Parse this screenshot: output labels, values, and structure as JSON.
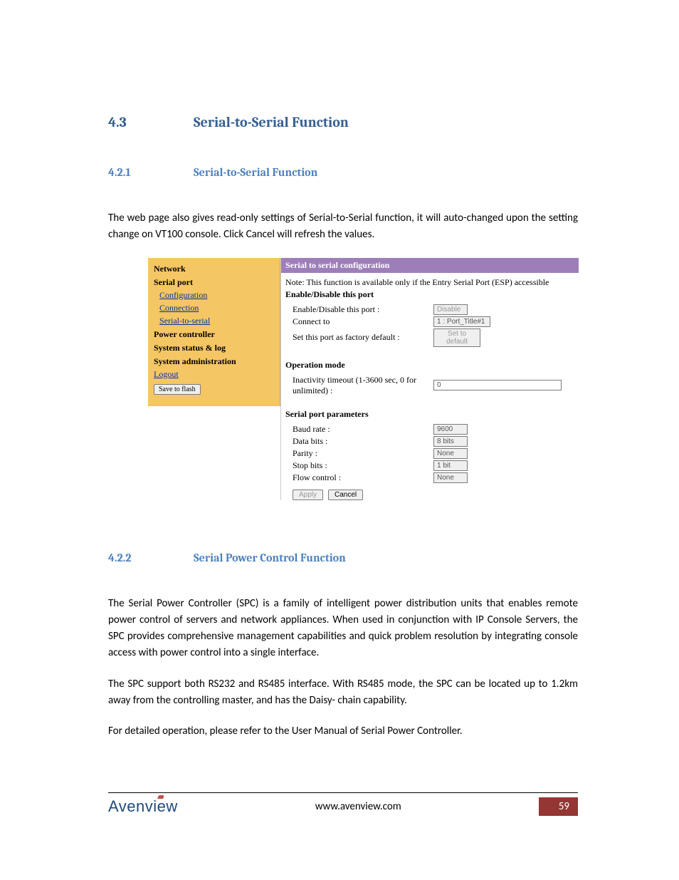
{
  "section43": {
    "number": "4.3",
    "title": "Serial-to-Serial Function"
  },
  "section421": {
    "number": "4.2.1",
    "title": "Serial-to-Serial Function"
  },
  "para421": "The web page also gives read-only settings of Serial-to-Serial function, it will auto-changed upon the setting change on VT100 console. Click Cancel will refresh the values.",
  "figure": {
    "sidebar": {
      "network": "Network",
      "serial_port": "Serial port",
      "links": [
        "Configuration",
        "Connection",
        "Serial-to-serial"
      ],
      "power_controller": "Power controller",
      "status_log": "System status & log",
      "sys_admin": "System administration",
      "logout": "Logout",
      "save_btn": "Save to flash"
    },
    "titlebar": "Serial to serial configuration",
    "note": "Note: This function is available only if the Entry Serial Port (ESP) accessible",
    "enable_section": "Enable/Disable this port",
    "rows": {
      "enable_label": "Enable/Disable this port :",
      "enable_val": "Disable",
      "connect_label": "Connect to",
      "connect_val": "1 : Port_Title#1",
      "factory_label": "Set this port as factory default :",
      "factory_btn": "Set to default"
    },
    "op_mode": "Operation mode",
    "inactivity_label": "Inactivity timeout (1-3600 sec, 0 for unlimited) :",
    "inactivity_val": "0",
    "spp": "Serial port parameters",
    "params": {
      "baud_label": "Baud rate :",
      "baud_val": "9600",
      "data_label": "Data bits :",
      "data_val": "8 bits",
      "parity_label": "Parity :",
      "parity_val": "None",
      "stop_label": "Stop bits :",
      "stop_val": "1 bit",
      "flow_label": "Flow control :",
      "flow_val": "None"
    },
    "apply": "Apply",
    "cancel": "Cancel"
  },
  "section422": {
    "number": "4.2.2",
    "title": "Serial Power Control Function"
  },
  "para422a": "The Serial Power Controller (SPC) is a family of intelligent power distribution units that enables remote power control of servers and network appliances. When used in conjunction with IP Console Servers, the SPC provides comprehensive management capabilities and quick problem resolution by integrating console access with power control into a single interface.",
  "para422b": "The SPC support both RS232 and RS485 interface. With RS485 mode, the SPC can be located up to 1.2km away from the controlling master, and has the Daisy- chain capability.",
  "para422c": "For detailed operation, please refer to the User Manual of Serial Power Controller.",
  "footer": {
    "url": "www.avenview.com",
    "page": "59",
    "brand": "Avenview"
  }
}
